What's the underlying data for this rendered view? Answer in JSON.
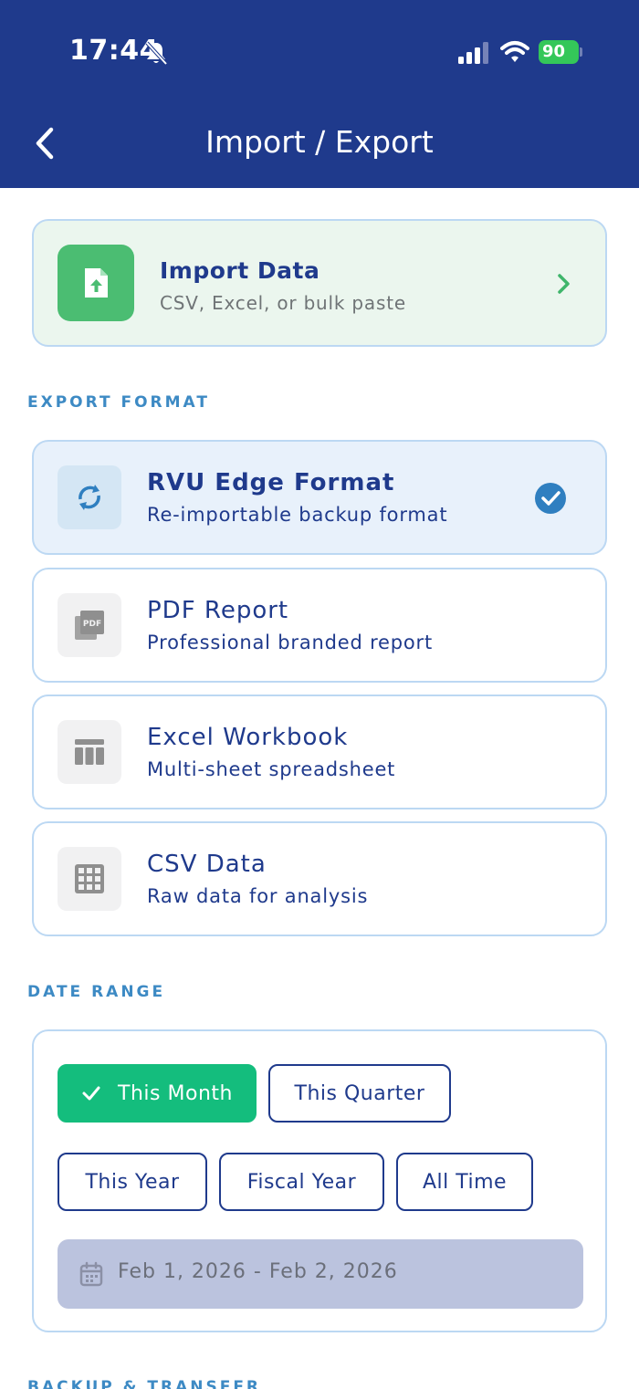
{
  "status_bar": {
    "time": "17:44",
    "battery": "90"
  },
  "nav": {
    "title": "Import / Export"
  },
  "import": {
    "title": "Import Data",
    "subtitle": "CSV, Excel, or bulk paste"
  },
  "export_section": {
    "label": "EXPORT FORMAT"
  },
  "formats": [
    {
      "title": "RVU Edge Format",
      "subtitle": "Re-importable backup format",
      "selected": true,
      "icon": "sync-icon"
    },
    {
      "title": "PDF Report",
      "subtitle": "Professional branded report",
      "selected": false,
      "icon": "pdf-icon"
    },
    {
      "title": "Excel Workbook",
      "subtitle": "Multi-sheet spreadsheet",
      "selected": false,
      "icon": "table-icon"
    },
    {
      "title": "CSV Data",
      "subtitle": "Raw data for analysis",
      "selected": false,
      "icon": "grid-icon"
    }
  ],
  "date_section": {
    "label": "DATE RANGE"
  },
  "date_range": {
    "chips": [
      "This Month",
      "This Quarter",
      "This Year",
      "Fiscal Year",
      "All Time"
    ],
    "selected": "This Month",
    "range_text": "Feb 1, 2026 - Feb 2, 2026"
  },
  "backup_section": {
    "label": "BACKUP & TRANSFER"
  },
  "colors": {
    "header": "#1f3a8c",
    "accent_green": "#14bd7d",
    "import_green": "#4bbd72",
    "section_blue": "#3d8ac4"
  }
}
